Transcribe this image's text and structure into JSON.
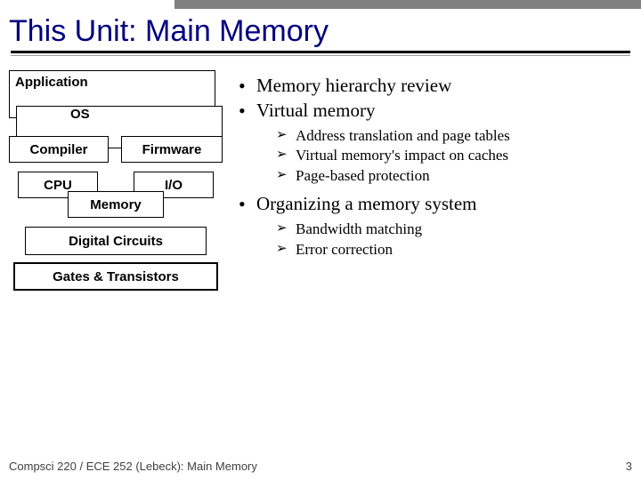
{
  "title": "This Unit: Main Memory",
  "stack": {
    "application": "Application",
    "os": "OS",
    "compiler": "Compiler",
    "firmware": "Firmware",
    "cpu": "CPU",
    "io": "I/O",
    "memory": "Memory",
    "digital_circuits": "Digital Circuits",
    "gates_transistors": "Gates & Transistors"
  },
  "bullets": {
    "b1": "Memory hierarchy review",
    "b2": "Virtual memory",
    "b2_sub": {
      "s1": "Address translation and page tables",
      "s2": "Virtual memory's impact on caches",
      "s3": "Page-based protection"
    },
    "b3": "Organizing a memory system",
    "b3_sub": {
      "s1": "Bandwidth matching",
      "s2": "Error correction"
    }
  },
  "footer": {
    "left": "Compsci 220 / ECE 252 (Lebeck): Main Memory",
    "right": "3"
  }
}
